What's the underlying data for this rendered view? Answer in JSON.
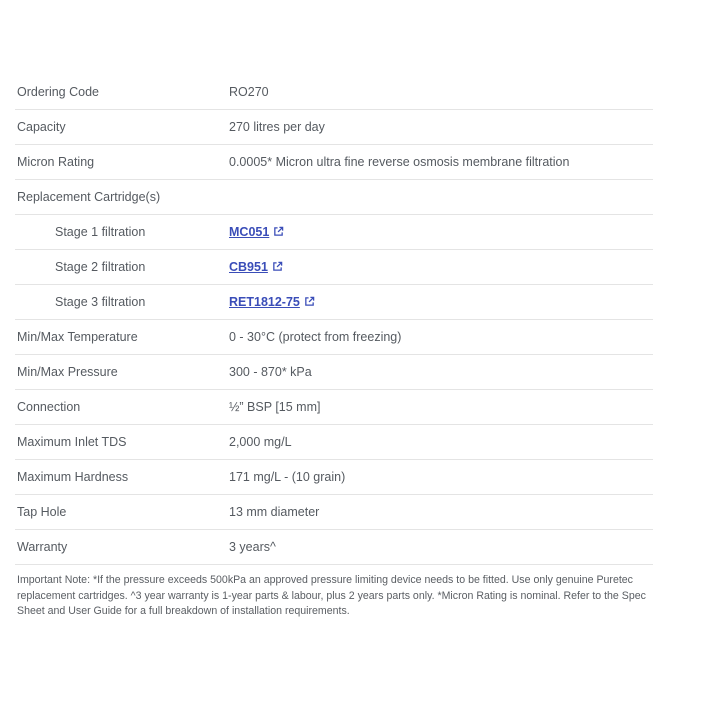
{
  "specs": {
    "rows": [
      {
        "label": "Ordering Code",
        "value": "RO270"
      },
      {
        "label": "Capacity",
        "value": "270 litres per day"
      },
      {
        "label": "Micron Rating",
        "value": "0.0005* Micron ultra fine reverse osmosis membrane filtration"
      },
      {
        "label": "Replacement Cartridge(s)",
        "value": ""
      },
      {
        "label": "Stage 1 filtration",
        "value": "MC051",
        "link": true
      },
      {
        "label": "Stage 2 filtration",
        "value": "CB951",
        "link": true
      },
      {
        "label": "Stage 3 filtration",
        "value": "RET1812-75",
        "link": true
      },
      {
        "label": "Min/Max Temperature",
        "value": "0 - 30°C (protect from freezing)"
      },
      {
        "label": "Min/Max Pressure",
        "value": "300 - 870* kPa"
      },
      {
        "label": "Connection",
        "value": "½” BSP [15 mm]"
      },
      {
        "label": "Maximum Inlet TDS",
        "value": "2,000 mg/L"
      },
      {
        "label": "Maximum Hardness",
        "value": "171 mg/L - (10 grain)"
      },
      {
        "label": "Tap Hole",
        "value": "13 mm diameter"
      },
      {
        "label": "Warranty",
        "value": "3 years^"
      }
    ]
  },
  "note": {
    "text": "Important Note: *If the pressure exceeds 500kPa an approved pressure limiting device needs to be fitted. Use only genuine Puretec replacement cartridges. ^3 year warranty is 1-year parts & labour, plus 2 years parts only. *Micron Rating is nominal. Refer to the Spec Sheet and User Guide for a full breakdown of installation requirements."
  },
  "colors": {
    "text": "#555a60",
    "link": "#3a4db8",
    "divider": "#e4e4e4"
  },
  "icons": {
    "external_link": "external-link-icon"
  }
}
